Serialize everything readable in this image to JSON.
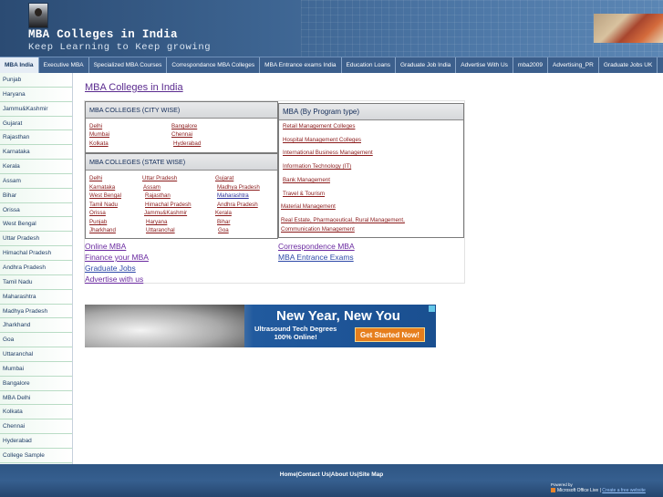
{
  "header": {
    "title": "MBA Colleges in India",
    "tagline": "Keep Learning to Keep growing"
  },
  "nav": {
    "items": [
      "MBA India",
      "Executive MBA",
      "Specialized MBA Courses",
      "Correspondance MBA Colleges",
      "MBA Entrance exams India",
      "Education Loans",
      "Graduate Job India",
      "Advertise With Us",
      "mba2009",
      "Advertising_PR",
      "Graduate Jobs UK"
    ],
    "active": "MBA India"
  },
  "sidebar": {
    "items": [
      "Punjab",
      "Haryana",
      "Jammu&Kashmir",
      "Gujarat",
      "Rajasthan",
      "Karnataka",
      "Kerala",
      "Assam",
      "Bihar",
      "Orissa",
      "West Bengal",
      "Uttar Pradesh",
      "Himachal Pradesh",
      "Andhra Pradesh",
      "Tamil Nadu",
      "Maharashtra",
      "Madhya Pradesh",
      "Jharkhand",
      "Goa",
      "Uttaranchal",
      "Mumbai",
      "Bangalore",
      "MBA Delhi",
      "Kolkata",
      "Chennai",
      "Hyderabad",
      "College Sample"
    ]
  },
  "main": {
    "page_title": "MBA Colleges in India",
    "city_box": {
      "heading": "MBA COLLEGES (CITY WISE)",
      "links": [
        "Delhi",
        "Bangalore",
        "Mumbai",
        "Chennai",
        "Kolkata",
        "Hyderabad"
      ]
    },
    "state_box": {
      "heading": "MBA COLLEGES (STATE WISE)",
      "links": [
        "Delhi",
        "Uttar Pradesh",
        "Gujarat",
        "Karnataka",
        "Assam",
        "Madhya Pradesh",
        "West Bengal",
        "Rajasthan",
        "Maharashtra",
        "Tamil Nadu",
        "Himachal Pradesh",
        "Andhra Pradesh",
        "Orissa",
        "Jammu&Kashmir",
        "Kerala",
        "Punjab",
        "Haryana",
        "Bihar",
        "Jharkhand",
        "Uttaranchal",
        "Goa"
      ]
    },
    "program_box": {
      "heading": "MBA (By Program type)",
      "links": [
        "Retail Management Colleges",
        "Hospital Management Colleges",
        "International Business Management",
        "Information Technology (IT)",
        "Bank Management",
        "Travel & Tourism",
        "Material Management",
        "Real Estate, Pharmaceutical, Rural Management,",
        "Communication Management"
      ]
    },
    "bottom_links": [
      "Online MBA",
      "Correspondence MBA",
      "Finance your MBA",
      "MBA Entrance Exams",
      "Graduate Jobs",
      "Advertise with us"
    ]
  },
  "ad": {
    "headline": "New Year, New You",
    "sub_line1": "Ultrasound Tech Degrees",
    "sub_line2": "100% Online!",
    "cta": "Get Started Now!"
  },
  "footer": {
    "links": [
      "Home",
      "Contact Us",
      "About Us",
      "Site Map"
    ],
    "separator": "|",
    "powered_by": "Powered by",
    "ms_office": "Microsoft Office Live",
    "ms_separator": "|",
    "create_site": "Create a free website"
  }
}
